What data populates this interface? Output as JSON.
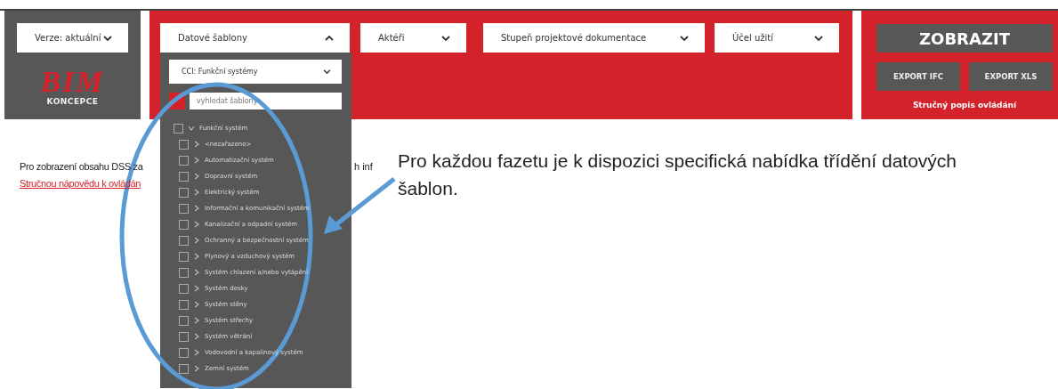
{
  "version_select": {
    "value": "Verze: aktuální"
  },
  "logo": {
    "mark": "BIM",
    "caption": "KONCEPCE"
  },
  "filters": [
    {
      "label": "Datové šablony",
      "expanded": true
    },
    {
      "label": "Aktéři",
      "expanded": false
    },
    {
      "label": "Stupeň projektové dokumentace",
      "expanded": false
    },
    {
      "label": "Účel užití",
      "expanded": false
    }
  ],
  "template_panel": {
    "classification": "CCI: Funkční systémy",
    "search": {
      "placeholder": "vyhledat šablony"
    },
    "tree": [
      {
        "label": "Funkční systém",
        "checked": false,
        "expanded": true,
        "children": [
          {
            "label": "<nezařazeno>",
            "checked": false,
            "expanded": false
          },
          {
            "label": "Automatizační systém",
            "checked": false,
            "expanded": false
          },
          {
            "label": "Dopravní systém",
            "checked": false,
            "expanded": false
          },
          {
            "label": "Elektrický systém",
            "checked": false,
            "expanded": false
          },
          {
            "label": "Informační a komunikační systém",
            "checked": false,
            "expanded": false
          },
          {
            "label": "Kanalizační a odpadní systém",
            "checked": false,
            "expanded": false
          },
          {
            "label": "Ochranný a bezpečnostní systém",
            "checked": false,
            "expanded": false
          },
          {
            "label": "Plynový a vzduchový systém",
            "checked": false,
            "expanded": false
          },
          {
            "label": "Systém chlazení a/nebo vytápění",
            "checked": false,
            "expanded": false
          },
          {
            "label": "Systém desky",
            "checked": false,
            "expanded": false
          },
          {
            "label": "Systém stěny",
            "checked": false,
            "expanded": false
          },
          {
            "label": "Systém střechy",
            "checked": false,
            "expanded": false
          },
          {
            "label": "Systém větrání",
            "checked": false,
            "expanded": false
          },
          {
            "label": "Vodovodní a kapalinový systém",
            "checked": false,
            "expanded": false
          },
          {
            "label": "Zemní systém",
            "checked": false,
            "expanded": false
          }
        ]
      }
    ]
  },
  "actions": {
    "primary": "ZOBRAZIT",
    "exports": [
      "EXPORT IFC",
      "EXPORT XLS"
    ],
    "help_link": "Stručný popis ovládání"
  },
  "intro": {
    "text": "Pro zobrazení obsahu DSS za",
    "text_tail": "h inf",
    "link": "Stručnou nápovědu k ovládán"
  },
  "annotation": {
    "text": "Pro každou fazetu je k dispozici specifická nabídka třídění datových šablon."
  }
}
